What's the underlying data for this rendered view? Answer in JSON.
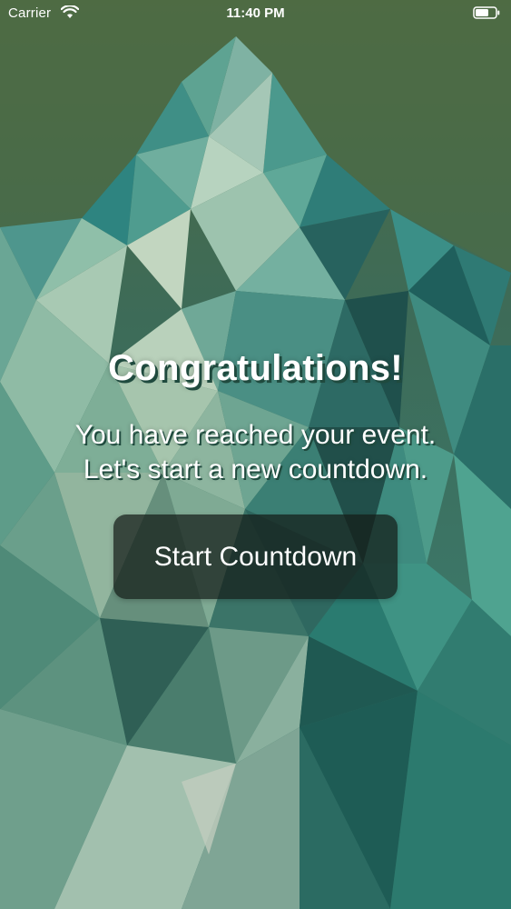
{
  "status_bar": {
    "carrier": "Carrier",
    "time": "11:40 PM",
    "wifi_icon": "wifi-icon",
    "battery_icon": "battery-icon"
  },
  "main": {
    "headline": "Congratulations!",
    "message_line_1": "You have reached your event.",
    "message_line_2": "Let's start a new countdown.",
    "button_label": "Start Countdown"
  },
  "colors": {
    "text": "#ffffff",
    "text_shadow": "#1f4a3e",
    "button_background": "#141c18",
    "background_top": "#4e6a44",
    "background_bottom": "#2f6a5f"
  }
}
